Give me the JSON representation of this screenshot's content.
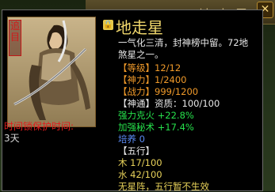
{
  "background": {
    "title": "地走星",
    "close_glyph": "✕"
  },
  "tooltip": {
    "name": "地走星",
    "lock_icon": "lock-icon",
    "stamp_text": "追 目",
    "lock_label": "时间锁保护时间:",
    "lock_value": "3天",
    "desc_line1": "一气化三清，封神榜中留。72地",
    "desc_line2": "煞星之一。",
    "level_label": "【等级】",
    "level_value": "12/12",
    "power_label": "【神力】",
    "power_value": "1/2400",
    "battle_label": "【战力】",
    "battle_value": "999/1200",
    "divine_label": "【神通】",
    "divine_value": "资质：100/100",
    "buff1": "强力克火 +22.8%",
    "buff2": "加强秘术 +17.4%",
    "cultivate": "培养 0",
    "elements_label": "【五行】",
    "wood": "木 17/100",
    "water": "水 42/100",
    "formation": "无星阵，五行暂不生效"
  }
}
